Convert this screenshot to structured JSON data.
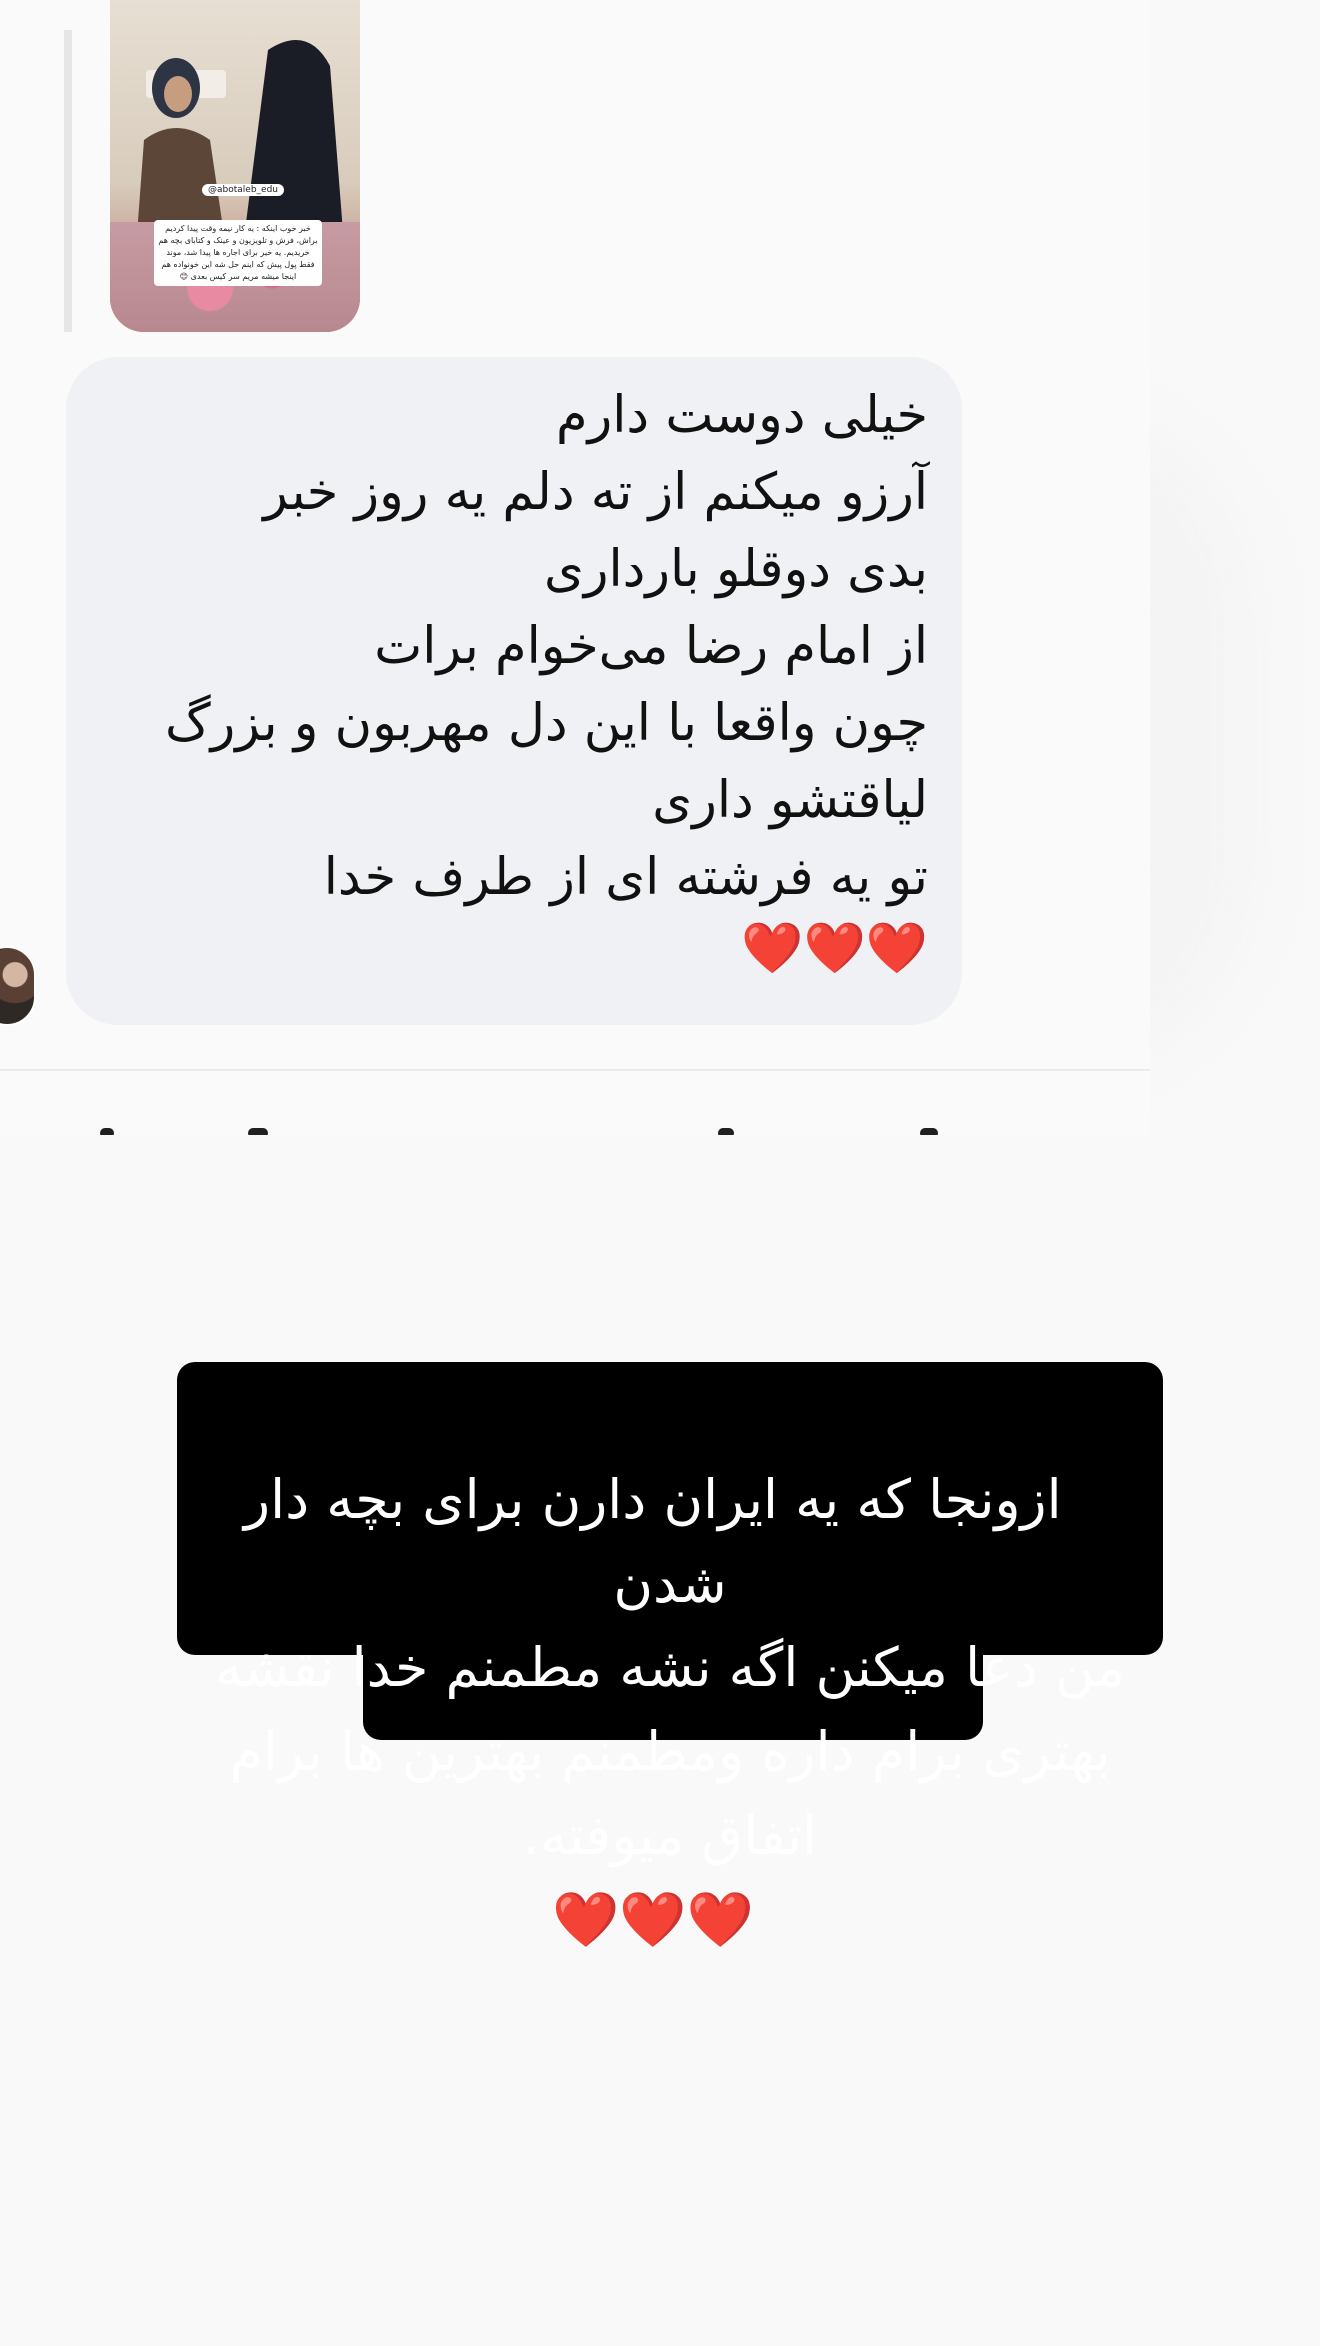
{
  "story_share": {
    "username_tag": "@abotaleb_edu",
    "caption_text": "خبر خوب اینکه : یه کار نیمه وقت پیدا کردیم براش، فرش و تلویزیون و عینک و کتابای بچه هم خریدیم. یه خیر برای اجاره ها پیدا شد، موند فقط پول پیش که اینم حل شه این خونواده هم اینجا میشه مریم سر کیس بعدی 😊"
  },
  "message": {
    "text": "خیلی دوست دارم\nآرزو میکنم از ته دلم یه روز خبر\nبدی دوقلو بارداری\nاز امام رضا می‌خوام برات\nچون واقعا با این دل مهربون و بزرگ\nلیاقتشو داری\nتو یه فرشته ای از طرف خدا",
    "emoji_line": "❤️❤️❤️"
  },
  "overlay": {
    "caption_text": "ازونجا که یه ایران دارن برای بچه دار شدن\nمن دعا میکنن اگه نشه مطمنم خدا نقشه\nبهتری برام داره ومطمنم بهترین ها برام\nاتفاق میوفته.",
    "emoji": "❤️❤️❤️"
  },
  "colors": {
    "page_bg": "#f9f9f9",
    "bubble_bg": "#f0f1f4",
    "overlay_bg": "#000000",
    "heart": "#e21b2b"
  }
}
